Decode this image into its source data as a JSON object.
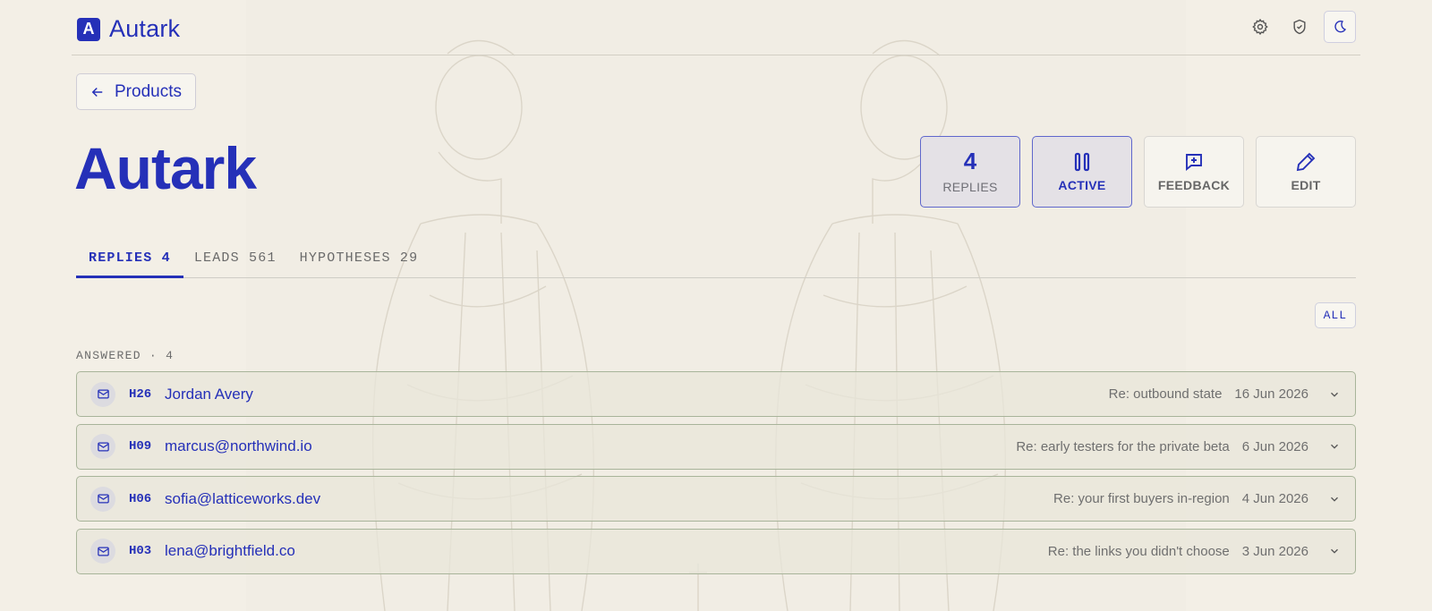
{
  "header": {
    "brand_letter": "A",
    "brand_name": "Autark",
    "icons": [
      "gear-icon",
      "shield-check-icon",
      "moon-icon"
    ]
  },
  "back_button": {
    "label": "Products"
  },
  "page": {
    "title": "Autark"
  },
  "stats": {
    "replies": {
      "value": "4",
      "label": "REPLIES"
    },
    "status": {
      "label": "ACTIVE"
    },
    "feedback": {
      "label": "FEEDBACK"
    },
    "edit": {
      "label": "EDIT"
    }
  },
  "tabs": [
    {
      "label": "REPLIES 4",
      "active": true
    },
    {
      "label": "LEADS 561",
      "active": false
    },
    {
      "label": "HYPOTHESES 29",
      "active": false
    }
  ],
  "filter": {
    "label": "ALL"
  },
  "section": {
    "label": "ANSWERED · 4"
  },
  "replies": [
    {
      "id": "H26",
      "contact": "Jordan Avery",
      "subject": "Re: outbound state",
      "date": "16 Jun 2026"
    },
    {
      "id": "H09",
      "contact": "marcus@northwind.io",
      "subject": "Re: early testers for the private beta",
      "date": "6 Jun 2026"
    },
    {
      "id": "H06",
      "contact": "sofia@latticeworks.dev",
      "subject": "Re: your first buyers in-region",
      "date": "4 Jun 2026"
    },
    {
      "id": "H03",
      "contact": "lena@brightfield.co",
      "subject": "Re: the links you didn't choose",
      "date": "3 Jun 2026"
    }
  ],
  "colors": {
    "accent": "#2530b8",
    "background": "#f3efe6",
    "row_border": "#a8b49a"
  }
}
